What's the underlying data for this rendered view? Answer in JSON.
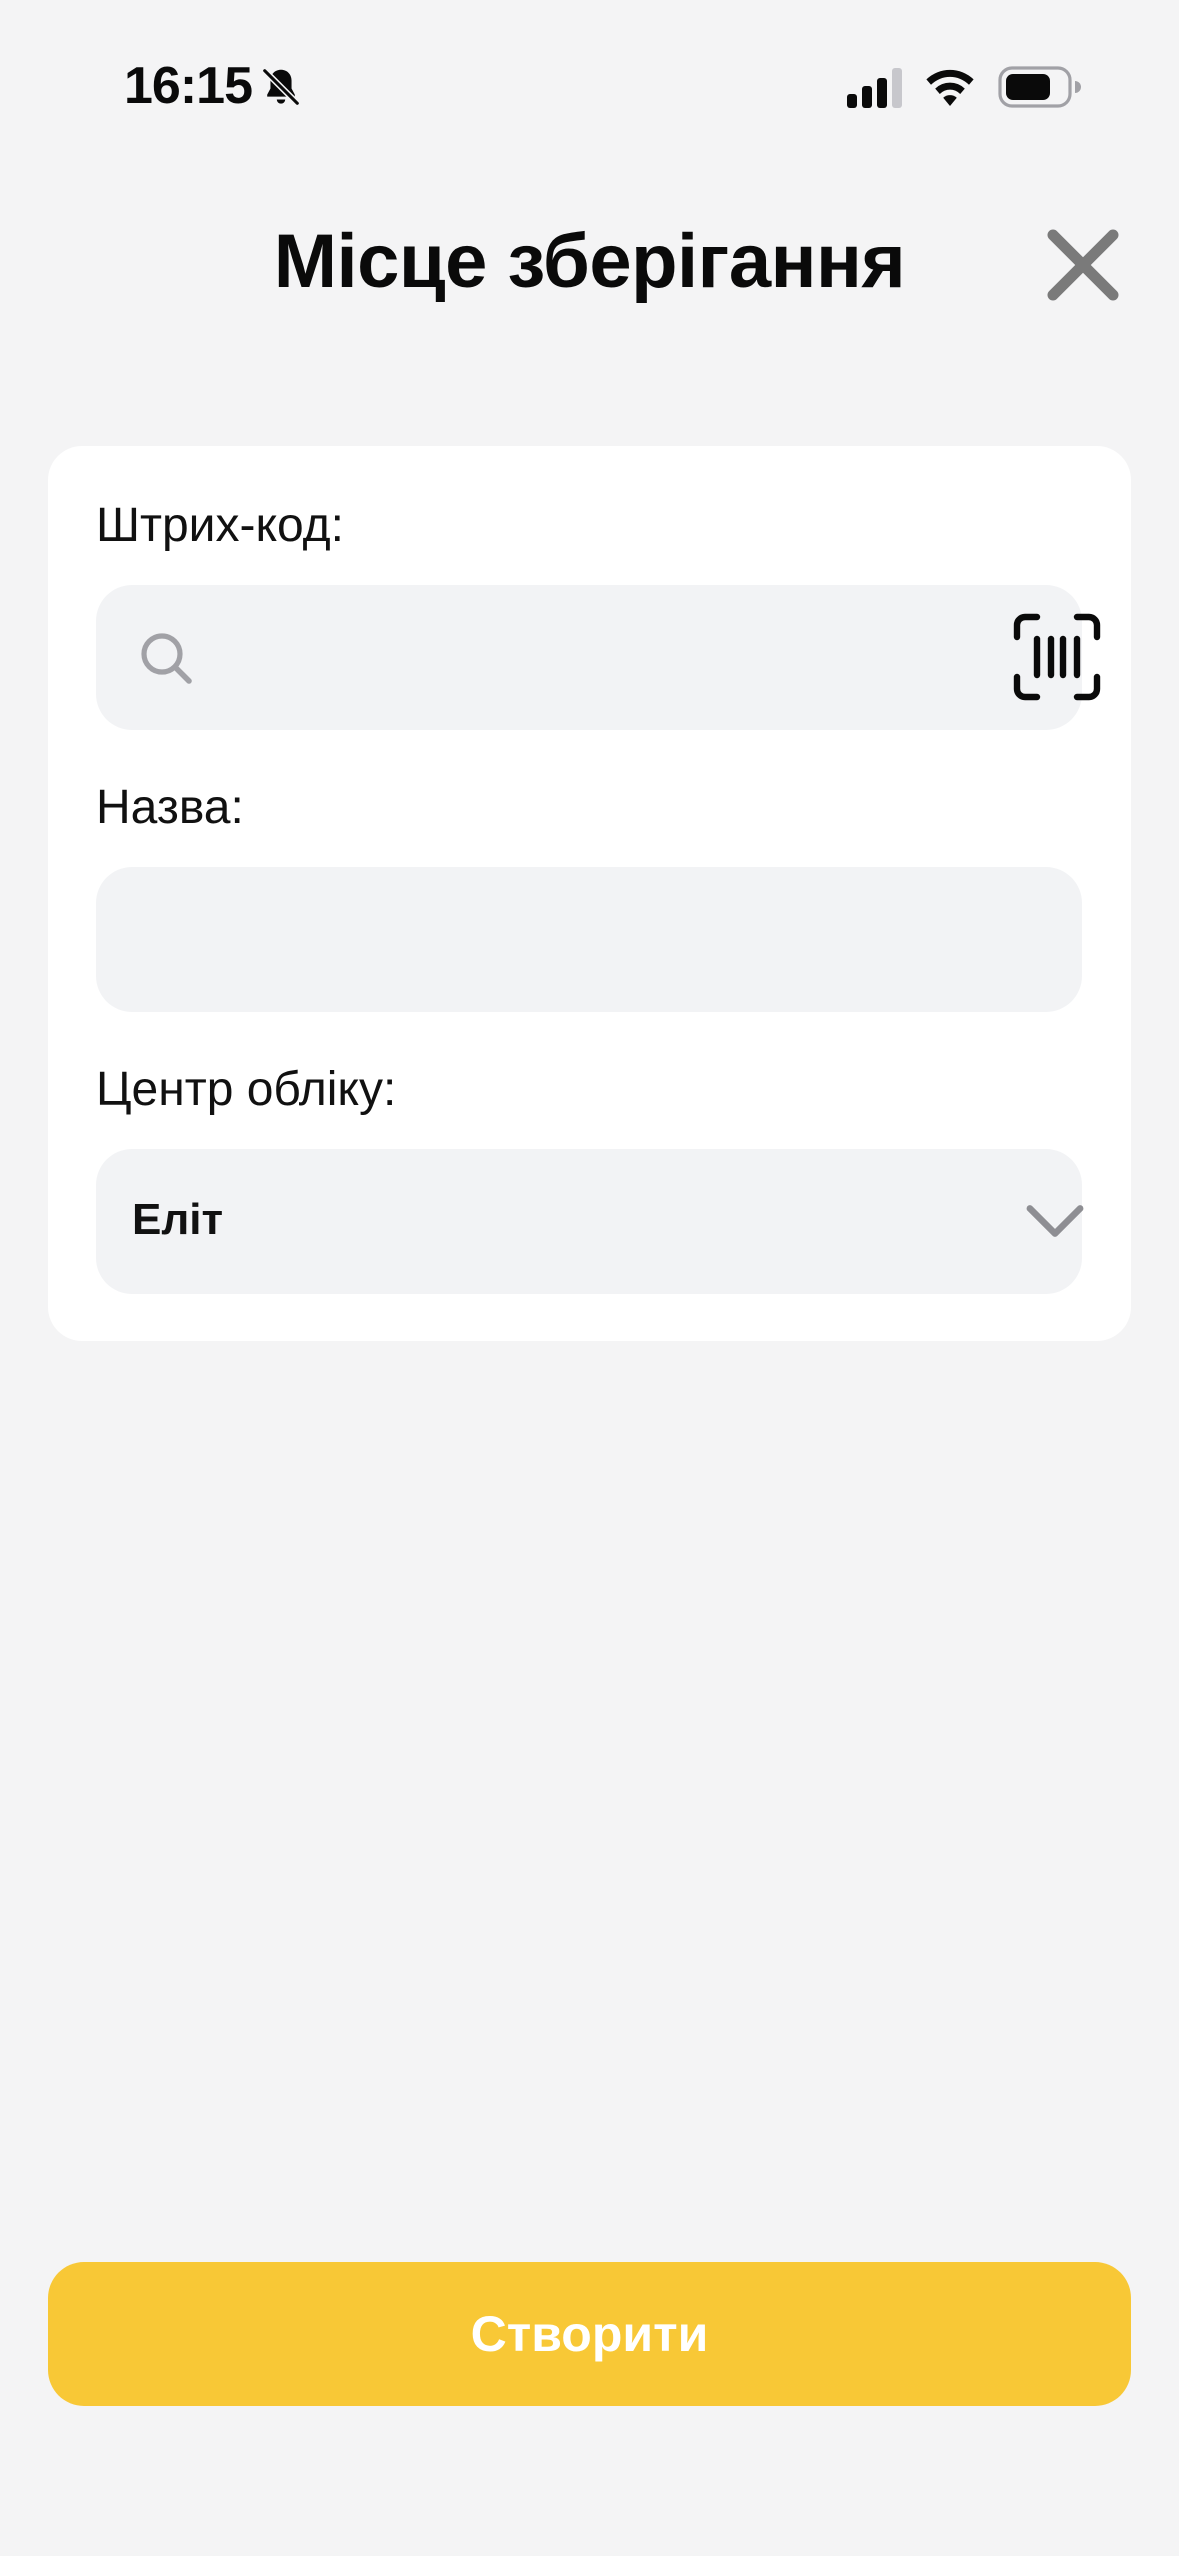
{
  "status_bar": {
    "time": "16:15",
    "icons": [
      "bell-slash-icon",
      "cellular-signal-icon",
      "wifi-icon",
      "battery-icon"
    ]
  },
  "header": {
    "title": "Місце зберігання",
    "close_icon": "close-icon"
  },
  "form": {
    "barcode": {
      "label": "Штрих-код:",
      "value": "",
      "search_icon": "search-icon",
      "scan_icon": "barcode-scan-icon"
    },
    "name": {
      "label": "Назва:",
      "value": ""
    },
    "accounting_center": {
      "label": "Центр обліку:",
      "selected": "Еліт",
      "icon": "chevron-down-icon"
    }
  },
  "actions": {
    "create_label": "Створити"
  },
  "colors": {
    "background": "#F4F4F5",
    "card": "#FFFFFF",
    "field": "#F2F3F5",
    "accent": "#F8C836",
    "icon_gray": "#8E8E93"
  }
}
